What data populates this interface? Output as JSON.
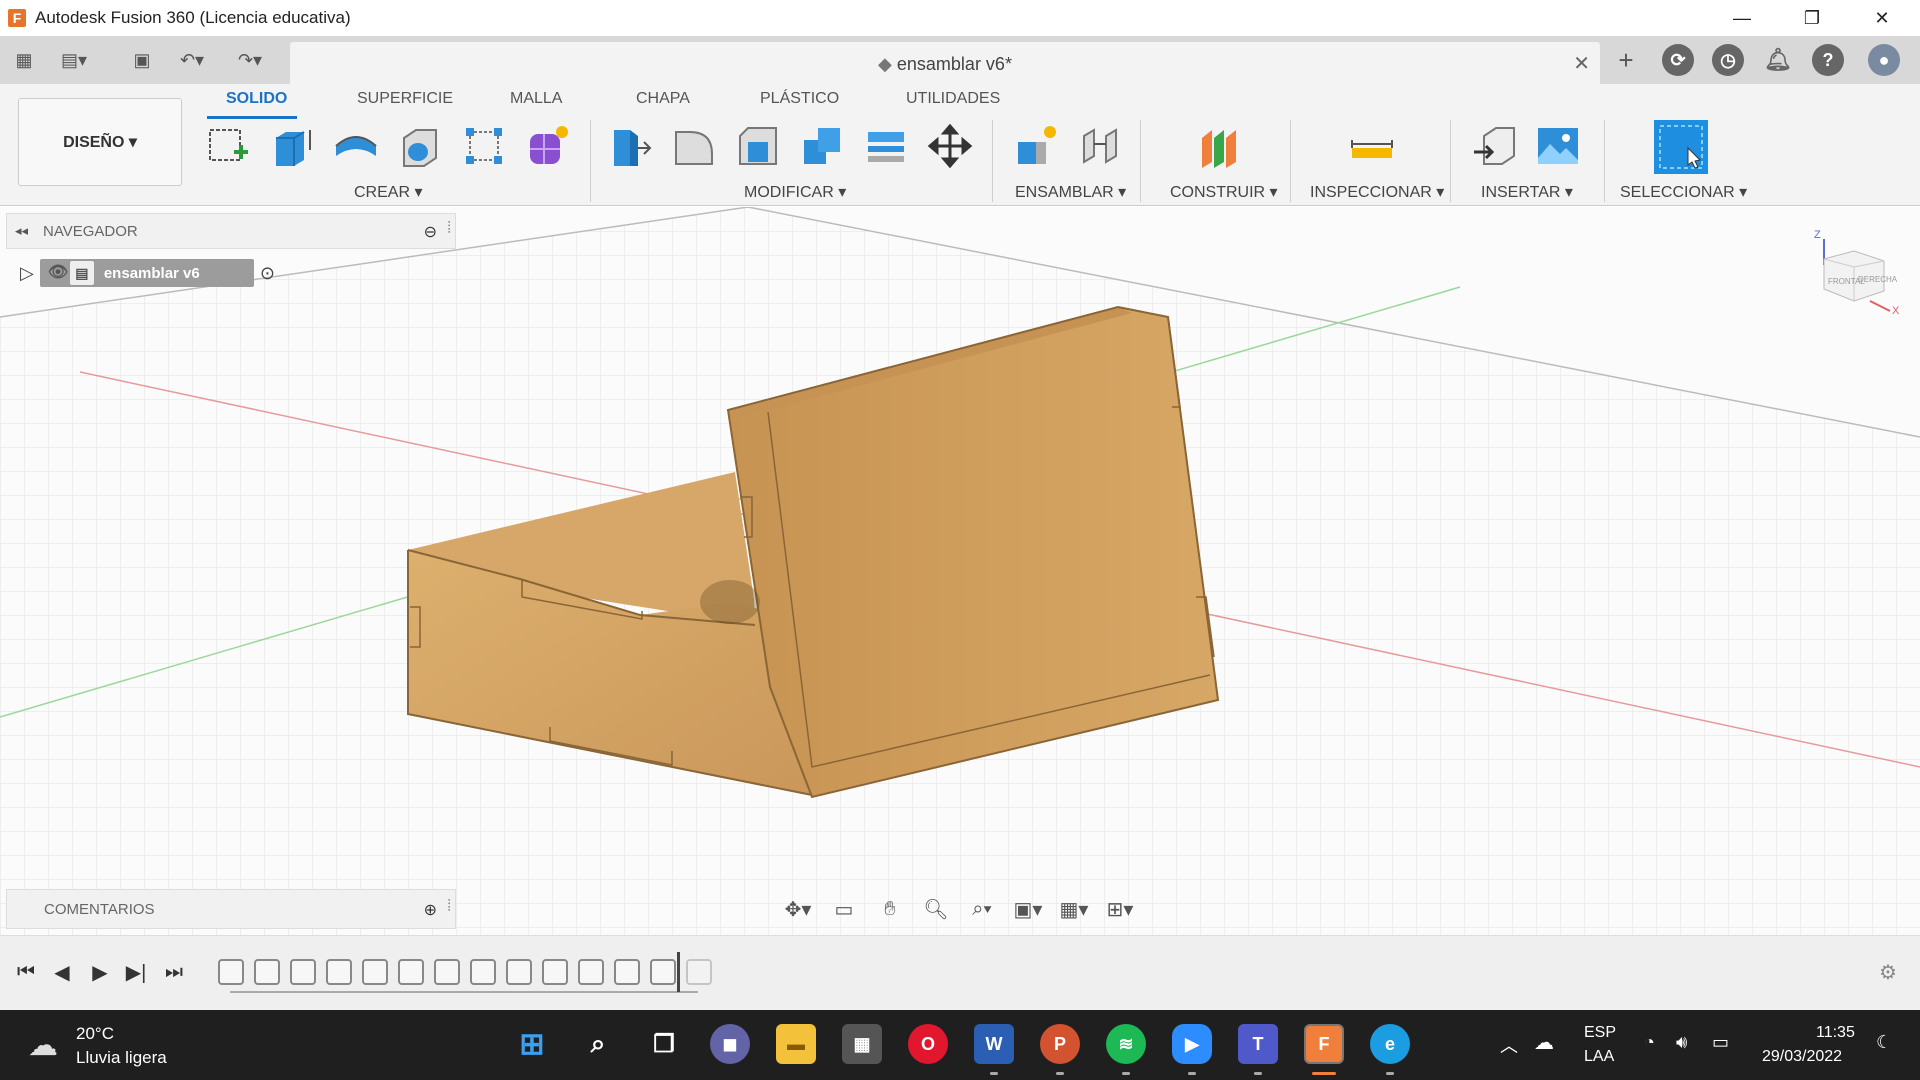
{
  "window": {
    "title": "Autodesk Fusion 360 (Licencia educativa)",
    "logo_letter": "F",
    "minimize": "—",
    "maximize": "❐",
    "close": "✕"
  },
  "document": {
    "title": "ensamblar v6*",
    "close": "✕"
  },
  "ribbon": {
    "workspace": "DISEÑO ▾",
    "tabs": [
      "SOLIDO",
      "SUPERFICIE",
      "MALLA",
      "CHAPA",
      "PLÁSTICO",
      "UTILIDADES"
    ],
    "groups": [
      "CREAR ▾",
      "MODIFICAR ▾",
      "ENSAMBLAR ▾",
      "CONSTRUIR ▾",
      "INSPECCIONAR ▾",
      "INSERTAR ▾",
      "SELECCIONAR ▾"
    ]
  },
  "navigator": {
    "title": "NAVEGADOR",
    "root_node": "ensamblar v6"
  },
  "comments": {
    "title": "COMENTARIOS"
  },
  "viewcube": {
    "z_label": "Z",
    "x_label": "X",
    "face_left": "FRONTAL",
    "face_right": "DERECHA"
  },
  "taskbar": {
    "temperature": "20°C",
    "weather": "Lluvia ligera",
    "lang_1": "ESP",
    "lang_2": "LAA",
    "time": "11:35",
    "date": "29/03/2022"
  },
  "colors": {
    "accent": "#1a73c9",
    "wood": "#d9a865",
    "wood_dark": "#b98a4c"
  }
}
